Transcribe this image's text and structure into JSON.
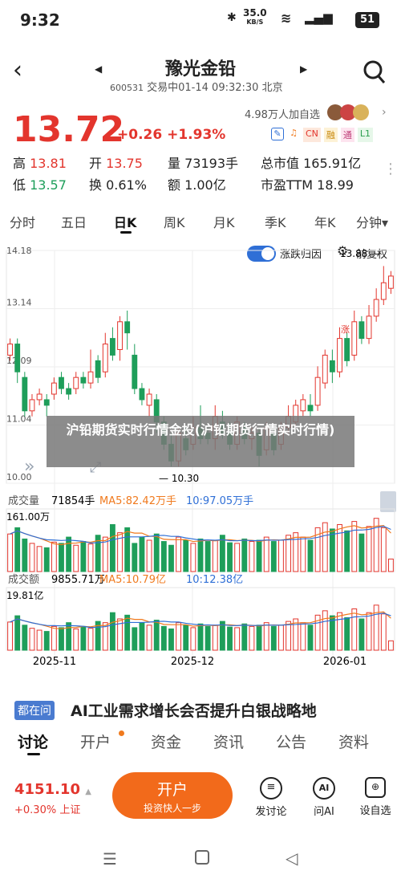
{
  "status": {
    "time": "9:32",
    "net": "35.0",
    "net_unit": "KB/S",
    "battery": "51"
  },
  "header": {
    "title": "豫光金铅",
    "code": "600531",
    "info": "交易中01-14 09:32:30 北京"
  },
  "quote": {
    "price": "13.72",
    "change": "+0.26 +1.93%",
    "followers": "4.98万人加自选",
    "tags": [
      "CN",
      "融",
      "通",
      "L1"
    ],
    "row1": [
      {
        "k": "高",
        "v": "13.81"
      },
      {
        "k": "开",
        "v": "13.75"
      },
      {
        "k": "量",
        "v": "73193手"
      },
      {
        "k": "总市值",
        "v": "165.91亿"
      }
    ],
    "row2": [
      {
        "k": "低",
        "v": "13.57"
      },
      {
        "k": "换",
        "v": "0.61%"
      },
      {
        "k": "额",
        "v": "1.00亿"
      },
      {
        "k": "市盈TTM",
        "v": "18.99"
      }
    ]
  },
  "tabs": [
    "分时",
    "五日",
    "日K",
    "周K",
    "月K",
    "季K",
    "年K",
    "分钟▾"
  ],
  "chart_opts": {
    "toggle_label": "涨跌归因",
    "restore_label": "前复权"
  },
  "chart_data": [
    {
      "type": "candlestick",
      "ylim": [
        10.0,
        14.18
      ],
      "y_ticks": [
        "14.18",
        "13.14",
        "12.09",
        "11.04",
        "10.00"
      ],
      "x_ticks": [
        "2025-11",
        "2025-12",
        "2026-01"
      ],
      "max_label": "13.88",
      "min_label": "10.30",
      "badge": "涨",
      "colors": {
        "up": "#e3352d",
        "down": "#1e9e5a"
      },
      "candles": [
        [
          12.3,
          12.5,
          12.2,
          12.6
        ],
        [
          12.5,
          12.0,
          11.8,
          12.6
        ],
        [
          11.9,
          11.3,
          11.2,
          12.0
        ],
        [
          11.3,
          11.5,
          11.2,
          11.6
        ],
        [
          11.5,
          11.6,
          11.4,
          11.7
        ],
        [
          11.5,
          11.4,
          11.2,
          11.6
        ],
        [
          11.6,
          11.8,
          11.5,
          11.9
        ],
        [
          11.9,
          11.7,
          11.6,
          12.0
        ],
        [
          11.7,
          11.6,
          11.5,
          11.8
        ],
        [
          11.7,
          11.9,
          11.6,
          12.0
        ],
        [
          11.9,
          11.8,
          11.7,
          12.0
        ],
        [
          11.8,
          12.0,
          11.7,
          12.4
        ],
        [
          12.2,
          11.9,
          11.8,
          12.3
        ],
        [
          12.0,
          12.5,
          11.9,
          12.7
        ],
        [
          12.6,
          12.3,
          12.2,
          12.8
        ],
        [
          12.4,
          12.9,
          12.2,
          13.0
        ],
        [
          12.9,
          12.7,
          12.4,
          13.1
        ],
        [
          12.3,
          11.7,
          11.6,
          12.5
        ],
        [
          11.7,
          11.5,
          11.4,
          11.8
        ],
        [
          11.4,
          11.6,
          11.2,
          11.7
        ],
        [
          11.5,
          11.1,
          10.9,
          11.6
        ],
        [
          11.1,
          10.7,
          10.6,
          11.2
        ],
        [
          10.7,
          10.4,
          10.3,
          10.9
        ],
        [
          10.4,
          10.9,
          10.3,
          11.0
        ],
        [
          10.8,
          10.6,
          10.5,
          11.0
        ],
        [
          10.7,
          11.0,
          10.6,
          11.2
        ],
        [
          11.0,
          10.8,
          10.7,
          11.4
        ],
        [
          10.9,
          10.8,
          10.7,
          11.0
        ],
        [
          10.8,
          11.2,
          10.6,
          11.4
        ],
        [
          11.1,
          10.9,
          10.8,
          11.3
        ],
        [
          10.9,
          10.7,
          10.6,
          11.1
        ],
        [
          10.7,
          11.1,
          10.6,
          11.2
        ],
        [
          11.0,
          10.8,
          10.7,
          11.1
        ],
        [
          10.8,
          10.9,
          10.6,
          11.0
        ],
        [
          10.9,
          10.5,
          10.3,
          11.0
        ],
        [
          10.6,
          11.0,
          10.5,
          11.1
        ],
        [
          10.9,
          10.6,
          10.5,
          11.0
        ],
        [
          10.7,
          11.0,
          10.6,
          11.1
        ],
        [
          11.0,
          11.2,
          10.9,
          11.4
        ],
        [
          11.1,
          11.4,
          11.0,
          11.5
        ],
        [
          11.3,
          11.5,
          11.2,
          11.6
        ],
        [
          11.4,
          11.3,
          11.2,
          11.6
        ],
        [
          11.4,
          11.9,
          11.3,
          12.1
        ],
        [
          11.8,
          12.3,
          11.7,
          12.4
        ],
        [
          12.2,
          12.0,
          11.8,
          12.4
        ],
        [
          12.0,
          12.6,
          11.9,
          12.8
        ],
        [
          12.6,
          12.2,
          12.1,
          12.7
        ],
        [
          12.3,
          12.9,
          12.2,
          13.1
        ],
        [
          12.9,
          12.6,
          12.5,
          13.0
        ],
        [
          12.6,
          13.0,
          12.5,
          13.2
        ],
        [
          13.0,
          13.3,
          12.9,
          13.5
        ],
        [
          13.3,
          13.6,
          13.2,
          13.9
        ],
        [
          13.5,
          13.72,
          13.4,
          13.81
        ]
      ]
    },
    {
      "type": "bar",
      "label": "成交量",
      "val": "71854手",
      "ma5": "MA5:82.42万手",
      "ma10": "10:97.05万手",
      "ymax_label": "161.00万",
      "values": [
        60,
        70,
        52,
        45,
        40,
        38,
        47,
        45,
        55,
        42,
        48,
        44,
        58,
        55,
        75,
        62,
        70,
        45,
        55,
        50,
        60,
        48,
        42,
        55,
        50,
        45,
        52,
        48,
        50,
        58,
        46,
        45,
        52,
        48,
        50,
        55,
        48,
        50,
        58,
        62,
        55,
        50,
        70,
        78,
        68,
        75,
        65,
        80,
        60,
        72,
        85,
        70,
        20
      ],
      "ups": [
        1,
        0,
        0,
        1,
        1,
        0,
        1,
        0,
        0,
        1,
        0,
        1,
        0,
        1,
        0,
        1,
        0,
        0,
        0,
        1,
        0,
        0,
        0,
        1,
        0,
        1,
        0,
        0,
        1,
        0,
        0,
        1,
        0,
        1,
        0,
        1,
        0,
        1,
        1,
        1,
        1,
        0,
        1,
        1,
        0,
        1,
        0,
        1,
        0,
        1,
        1,
        1,
        1
      ]
    },
    {
      "type": "bar",
      "label": "成交额",
      "val": "9855.71万",
      "ma5": "MA5:10.79亿",
      "ma10": "10:12.38亿",
      "ymax_label": "19.81亿",
      "values": [
        45,
        55,
        40,
        35,
        32,
        30,
        38,
        36,
        44,
        34,
        38,
        35,
        46,
        44,
        60,
        50,
        56,
        36,
        44,
        40,
        48,
        38,
        34,
        44,
        40,
        36,
        42,
        38,
        40,
        46,
        37,
        36,
        42,
        38,
        40,
        44,
        38,
        40,
        46,
        50,
        44,
        40,
        56,
        63,
        55,
        60,
        52,
        66,
        50,
        60,
        72,
        58,
        15
      ],
      "ups": [
        1,
        0,
        0,
        1,
        1,
        0,
        1,
        0,
        0,
        1,
        0,
        1,
        0,
        1,
        0,
        1,
        0,
        0,
        0,
        1,
        0,
        0,
        0,
        1,
        0,
        1,
        0,
        0,
        1,
        0,
        0,
        1,
        0,
        1,
        0,
        1,
        0,
        1,
        1,
        1,
        1,
        0,
        1,
        1,
        0,
        1,
        0,
        1,
        0,
        1,
        1,
        1,
        1
      ]
    }
  ],
  "overlay": "沪铅期货实时行情金投(沪铅期货行情实时行情)",
  "news": {
    "badge": "都在问",
    "text": "AI工业需求增长会否提升白银战略地"
  },
  "btabs": [
    "讨论",
    "开户",
    "资金",
    "资讯",
    "公告",
    "资料"
  ],
  "index": {
    "val": "4151.10",
    "chg": "+0.30% 上证"
  },
  "open": {
    "t": "开户",
    "s": "投资快人一步"
  },
  "actions": [
    "发讨论",
    "问AI",
    "设自选"
  ]
}
